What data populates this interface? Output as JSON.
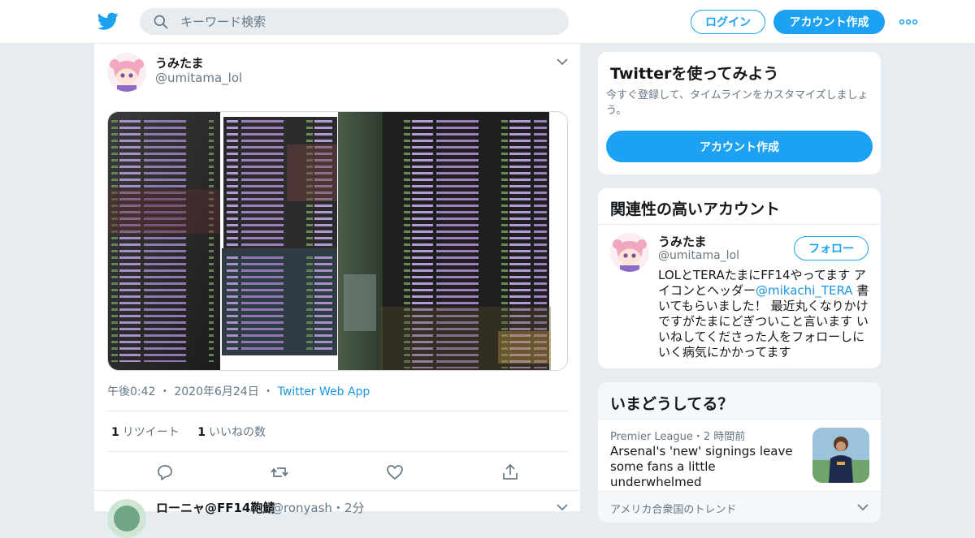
{
  "header": {
    "logo_icon": "twitter-bird-icon",
    "search_placeholder": "キーワード検索",
    "login_label": "ログイン",
    "signup_label": "アカウント作成",
    "more_icon": "more-horizontal-icon"
  },
  "tweet": {
    "author_name": "うみたま",
    "author_handle": "@umitama_lol",
    "time": "午後0:42",
    "date": "2020年6月24日",
    "source": "Twitter Web App",
    "retweet_count": "1",
    "retweet_label": "リツイート",
    "like_count": "1",
    "like_label": "いいねの数"
  },
  "next_tweet": {
    "author_name": "ローニャ@FF14鞄鯖",
    "author_handle": "@ronyash",
    "age": "2分"
  },
  "try_card": {
    "title": "Twitterを使ってみよう",
    "subtitle": "今すぐ登録して、タイムラインをカスタマイズしましょう。",
    "button": "アカウント作成"
  },
  "related_card": {
    "title": "関連性の高いアカウント",
    "name": "うみたま",
    "handle": "@umitama_lol",
    "follow_label": "フォロー",
    "bio_part1": "LOLとTERAたまにFF14やってます アイコンとヘッダー",
    "bio_mention": "@mikachi_TERA",
    "bio_part2": " 書いてもらいました！ 最近丸くなりかけですがたまにどぎついこと言います いいねしてくださった人をフォローしにいく病気にかかってます"
  },
  "trends_card": {
    "title": "いまどうしてる？",
    "item_category": "Premier League",
    "item_age": "2 時間前",
    "item_title": "Arsenal's 'new' signings leave some fans a little underwhelmed",
    "next_label": "アメリカ合衆国のトレンド"
  },
  "colors": {
    "accent": "#1da1f2",
    "link": "#1b95e0",
    "background": "#e6ecf0"
  }
}
